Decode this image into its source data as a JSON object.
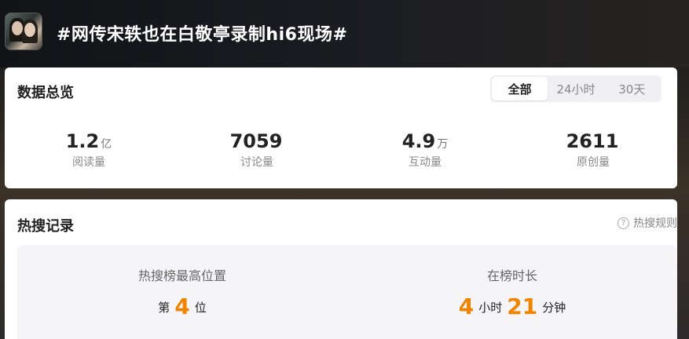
{
  "header": {
    "title": "#网传宋轶也在白敬亭录制hi6现场#",
    "avatar_icon": "topic-avatar"
  },
  "overview": {
    "title": "数据总览",
    "tabs": [
      {
        "label": "全部",
        "active": true
      },
      {
        "label": "24小时",
        "active": false
      },
      {
        "label": "30天",
        "active": false
      }
    ],
    "stats": [
      {
        "value": "1.2",
        "unit": "亿",
        "label": "阅读量"
      },
      {
        "value": "7059",
        "unit": "",
        "label": "讨论量"
      },
      {
        "value": "4.9",
        "unit": "万",
        "label": "互动量"
      },
      {
        "value": "2611",
        "unit": "",
        "label": "原创量"
      }
    ]
  },
  "hot_search": {
    "title": "热搜记录",
    "rules_label": "热搜规则",
    "rules_icon": "question-circle-icon",
    "highest_rank": {
      "caption": "热搜榜最高位置",
      "prefix": "第",
      "value": "4",
      "suffix": "位"
    },
    "duration": {
      "caption": "在榜时长",
      "hours": "4",
      "hours_unit": "小时",
      "minutes": "21",
      "minutes_unit": "分钟"
    }
  },
  "colors": {
    "accent": "#f08300",
    "header_bg": "#15171d"
  }
}
